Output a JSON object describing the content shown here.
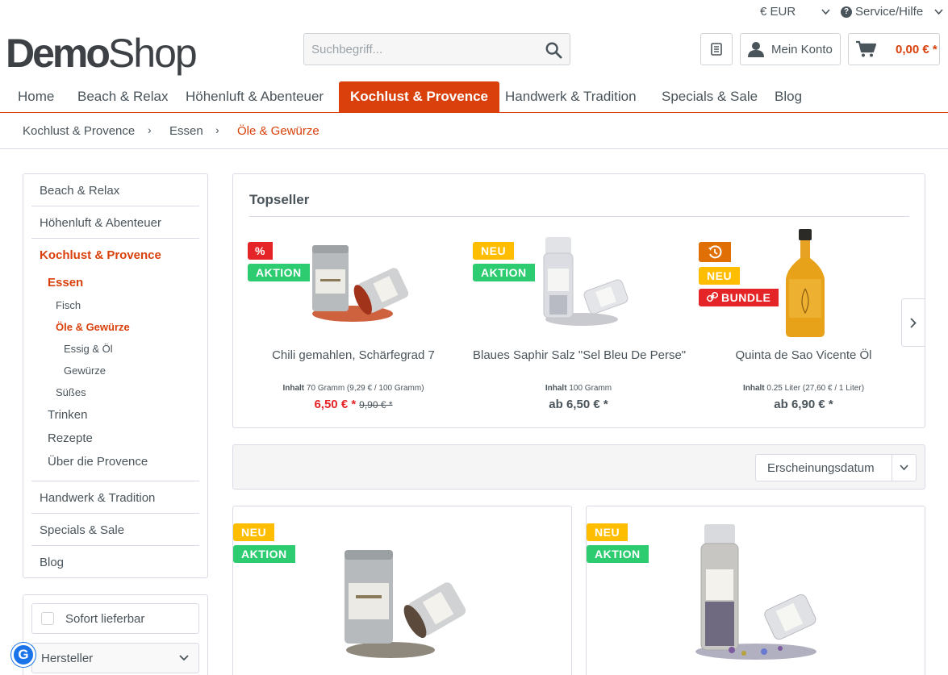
{
  "topbar": {
    "currency": "€ EUR",
    "service": "Service/Hilfe"
  },
  "header": {
    "logo_part1": "Demo",
    "logo_part2": "Shop",
    "search_placeholder": "Suchbegriff...",
    "account_label": "Mein Konto",
    "cart_amount": "0,00 € *"
  },
  "nav": {
    "items": [
      "Home",
      "Beach & Relax",
      "Höhenluft & Abenteuer",
      "Kochlust & Provence",
      "Handwerk & Tradition",
      "Specials & Sale",
      "Blog"
    ],
    "active_index": 3
  },
  "breadcrumb": [
    "Kochlust & Provence",
    "Essen",
    "Öle & Gewürze"
  ],
  "sidebar": {
    "items": [
      "Beach & Relax",
      "Höhenluft & Abenteuer",
      "Kochlust & Provence",
      "Essen",
      "Fisch",
      "Öle & Gewürze",
      "Essig & Öl",
      "Gewürze",
      "Süßes",
      "Trinken",
      "Rezepte",
      "Über die Provence",
      "Handwerk & Tradition",
      "Specials & Sale",
      "Blog"
    ]
  },
  "filters": {
    "instant_delivery": "Sofort lieferbar",
    "manufacturer": "Hersteller"
  },
  "topseller": {
    "title": "Topseller",
    "products": [
      {
        "name": "Chili gemahlen, Schärfegrad 7",
        "content_label": "Inhalt",
        "content": "70 Gramm (9,29 € / 100 Gramm)",
        "price": "6,50 € *",
        "old_price": "9,90 € *",
        "badges": [
          "%",
          "AKTION"
        ]
      },
      {
        "name": "Blaues Saphir Salz \"Sel Bleu De Perse\"",
        "content_label": "Inhalt",
        "content": "100 Gramm",
        "price": "ab 6,50 € *",
        "badges": [
          "NEU",
          "AKTION"
        ]
      },
      {
        "name": "Quinta de Sao Vicente Öl",
        "content_label": "Inhalt",
        "content": "0.25 Liter (27,60 € / 1 Liter)",
        "price": "ab 6,90 € *",
        "badges": [
          "NEU",
          "BUNDLE"
        ]
      }
    ]
  },
  "sorting": {
    "selected": "Erscheinungsdatum"
  },
  "listing": {
    "products": [
      {
        "badges": [
          "NEU",
          "AKTION"
        ]
      },
      {
        "badges": [
          "NEU",
          "AKTION"
        ]
      }
    ]
  },
  "colors": {
    "accent": "#d9400b",
    "sale_red": "#e52427",
    "badge_green": "#2ecc71",
    "badge_yellow": "#ffbd00"
  }
}
